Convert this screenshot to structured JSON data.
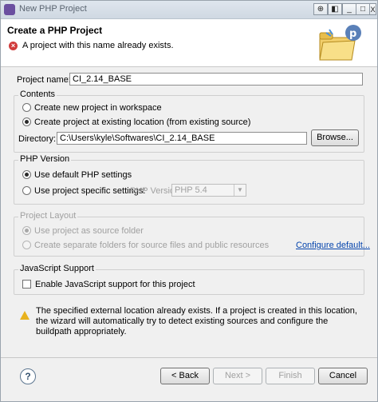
{
  "window": {
    "title": "New PHP Project",
    "controls": {
      "pin": "⊕",
      "restore": "◧",
      "minimize": "_",
      "maximize": "□",
      "close": "X"
    }
  },
  "header": {
    "title": "Create a PHP Project",
    "error_message": "A project with this name already exists.",
    "error_icon": "error-icon",
    "wizard_icon": "php-folder-wizard-icon"
  },
  "project_name": {
    "label": "Project name:",
    "value": "CI_2.14_BASE"
  },
  "contents": {
    "title": "Contents",
    "option_new": "Create new project in workspace",
    "option_existing": "Create project at existing location (from existing source)",
    "selected": "existing",
    "directory_label": "Directory:",
    "directory_value": "C:\\Users\\kyle\\Softwares\\CI_2.14_BASE",
    "browse": "Browse..."
  },
  "php_version": {
    "title": "PHP Version",
    "option_default": "Use default PHP settings",
    "option_specific": "Use project specific settings:",
    "selected": "default",
    "version_label": "PHP Version:",
    "version_value": "PHP 5.4"
  },
  "project_layout": {
    "title": "Project Layout",
    "option_source": "Use project as source folder",
    "option_separate": "Create separate folders for source files and public resources",
    "configure_link": "Configure default..."
  },
  "javascript": {
    "title": "JavaScript Support",
    "checkbox_label": "Enable JavaScript support for this project",
    "checked": false
  },
  "warning": {
    "icon": "warning-icon",
    "text": "The specified external location already exists. If a project is created in this location, the wizard will automatically try to detect existing sources and configure the buildpath appropriately."
  },
  "footer": {
    "help": "?",
    "back": "< Back",
    "next": "Next >",
    "finish": "Finish",
    "cancel": "Cancel"
  }
}
